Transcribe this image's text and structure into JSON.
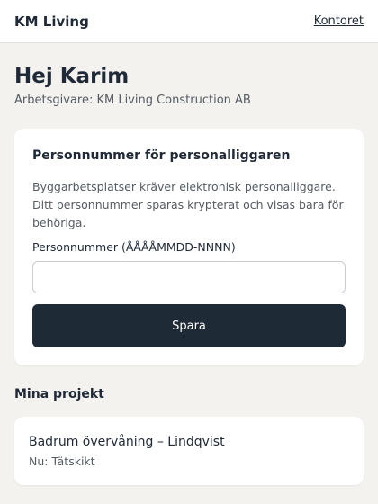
{
  "header": {
    "brand": "KM Living",
    "office_link": "Kontoret"
  },
  "greeting": {
    "title": "Hej Karim",
    "employer": "Arbetsgivare: KM Living Construction AB"
  },
  "personnummer_card": {
    "title": "Personnummer för personalliggaren",
    "description": "Byggarbetsplatser kräver elektronisk personalliggare. Ditt personnummer sparas krypterat och visas bara för behöriga.",
    "field_label": "Personnummer (ÅÅÅÅMMDD-NNNN)",
    "field_value": "",
    "save_label": "Spara"
  },
  "projects": {
    "title": "Mina projekt",
    "items": [
      {
        "name": "Badrum övervåning – Lindqvist",
        "phase": "Nu: Tätskikt"
      }
    ]
  },
  "colors": {
    "background": "#f3f2ef",
    "surface": "#ffffff",
    "primary_button": "#1f2a37",
    "text": "#1f2937",
    "muted_text": "#555b63"
  }
}
